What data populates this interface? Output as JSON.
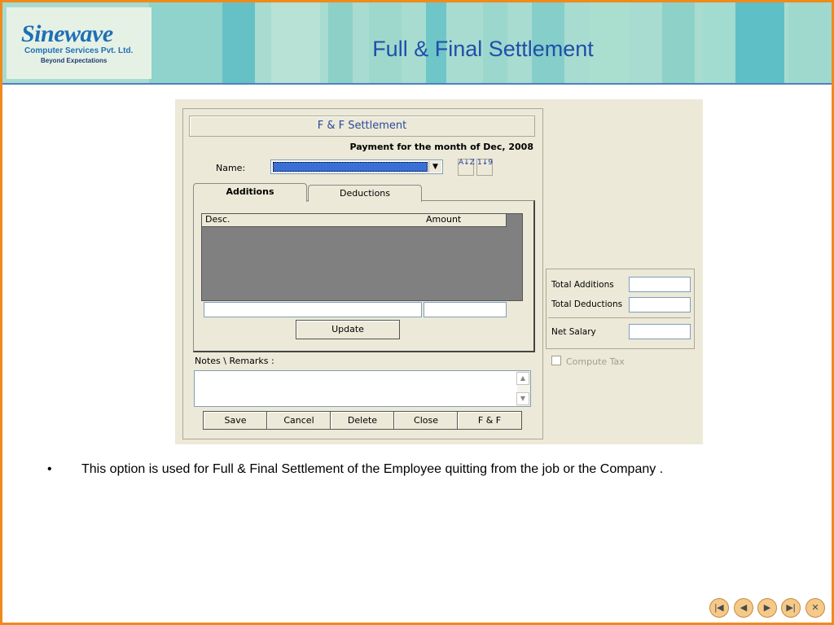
{
  "slide": {
    "title": "Full & Final Settlement",
    "logo": {
      "name": "Sinewave",
      "company": "Computer Services Pvt. Ltd.",
      "tagline": "Beyond  Expectations"
    },
    "bullet": "•",
    "bullet_text": "This option is used for Full & Final Settlement of  the Employee quitting from the job or the Company  ."
  },
  "form": {
    "header": "F & F Settlement",
    "payment_text": "Payment for the month of Dec, 2008",
    "name_label": "Name:",
    "sort_az": "A↓Z",
    "sort_19": "1↓9",
    "tabs": [
      {
        "label": "Additions",
        "active": true
      },
      {
        "label": "Deductions",
        "active": false
      }
    ],
    "grid_columns": [
      "Desc.",
      "Amount"
    ],
    "update_button": "Update",
    "notes_label": "Notes \\ Remarks :",
    "buttons": [
      "Save",
      "Cancel",
      "Delete",
      "Close",
      "F & F"
    ],
    "totals": [
      {
        "label": "Total Additions",
        "value": ""
      },
      {
        "label": "Total Deductions",
        "value": ""
      },
      {
        "label": "Net Salary",
        "value": ""
      }
    ],
    "compute_tax_label": "Compute Tax",
    "compute_tax_checked": false
  },
  "nav_icons": [
    "first-slide-icon",
    "previous-slide-icon",
    "next-slide-icon",
    "last-slide-icon",
    "close-icon"
  ]
}
